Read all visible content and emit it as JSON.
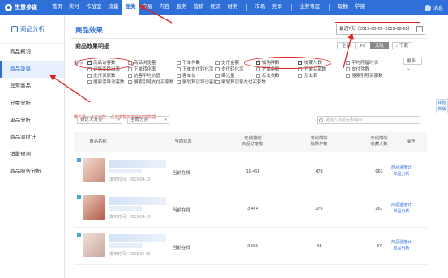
{
  "app": {
    "name": "生意参谋"
  },
  "nav": {
    "items": [
      "首页",
      "实时",
      "作战室",
      "流量",
      "品类",
      "交易",
      "内容",
      "服务",
      "营销",
      "物流",
      "财务"
    ],
    "active_index": 4,
    "group2": [
      "市场",
      "竞争"
    ],
    "group3": [
      "业务专区"
    ],
    "group4": [
      "取数",
      "学院"
    ]
  },
  "user": {
    "label": "消息"
  },
  "sidebar": {
    "title": "商品分析",
    "items": [
      "商品概况",
      "商品效果",
      "异常商品",
      "分类分析",
      "单品分析",
      "商品温度计",
      "销量预测",
      "商品服务分析"
    ],
    "active_index": 1
  },
  "main": {
    "title": "商品效果",
    "date_range": "最近7天（2019-08-22~2019-08-28）",
    "section_title": "商品效果明细",
    "device_tabs": [
      "全部",
      "PC",
      "无线"
    ],
    "device_active": 2,
    "download_label": "下载"
  },
  "indicators": {
    "label": "指标:",
    "items": [
      {
        "label": "商品访客数",
        "checked": true
      },
      {
        "label": "商品浏览量",
        "checked": false
      },
      {
        "label": "下单件数",
        "checked": false
      },
      {
        "label": "支付金额",
        "checked": false
      },
      {
        "label": "加购件数",
        "checked": true
      },
      {
        "label": "收藏人数",
        "checked": true
      },
      {
        "label": "平均停留时长",
        "checked": false
      },
      {
        "label": "详情页跳出率",
        "checked": false
      },
      {
        "label": "下单转化率",
        "checked": false
      },
      {
        "label": "下单支付转化率",
        "checked": false
      },
      {
        "label": "支付转化率",
        "checked": false
      },
      {
        "label": "下单金额",
        "checked": false
      },
      {
        "label": "下单买家数",
        "checked": false
      },
      {
        "label": "支付件数",
        "checked": false
      },
      {
        "label": "支付买家数",
        "checked": false
      },
      {
        "label": "访客平均价值",
        "checked": false
      },
      {
        "label": "客单价",
        "checked": false
      },
      {
        "label": "曝光量",
        "checked": false
      },
      {
        "label": "点击次数",
        "checked": false
      },
      {
        "label": "点击率",
        "checked": false
      },
      {
        "label": "搜索引导买家数",
        "checked": false
      },
      {
        "label": "搜索引导访客数",
        "checked": false
      },
      {
        "label": "搜索引导支付买家数",
        "checked": false
      },
      {
        "label": "聚划算引导访客数",
        "checked": false
      },
      {
        "label": "聚划算引导支付买家数",
        "checked": false
      }
    ],
    "more_label": "更多",
    "note": "曝光量、点击次数、点击率暂只支持PC端数据"
  },
  "filters": {
    "category_select": "自定义分类",
    "all_select": "全部分类",
    "search_placeholder": "请输入商品名称或ID"
  },
  "table": {
    "headers": [
      "商品名称",
      "当前状态",
      "无线端的\n商品访客数",
      "无线端的\n加购件数",
      "无线端的\n收藏人数",
      "操作"
    ],
    "rows": [
      {
        "date": "发布时间：2019-04-10",
        "status": "当前在线",
        "visitors": "18,463",
        "cart": "478",
        "fav": "663"
      },
      {
        "date": "发布时间：2019-04-10",
        "status": "当前在线",
        "visitors": "3,474",
        "cart": "276",
        "fav": "267"
      },
      {
        "date": "发布时间：2018-06-26",
        "status": "当前在线",
        "visitors": "2,050",
        "cart": "81",
        "fav": "97"
      }
    ],
    "op1": "商品温度计",
    "op2": "单品分析"
  },
  "float_btn": "体验\n新版",
  "colors": {
    "brand": "#2f6fd8",
    "annotation": "#e02020"
  }
}
